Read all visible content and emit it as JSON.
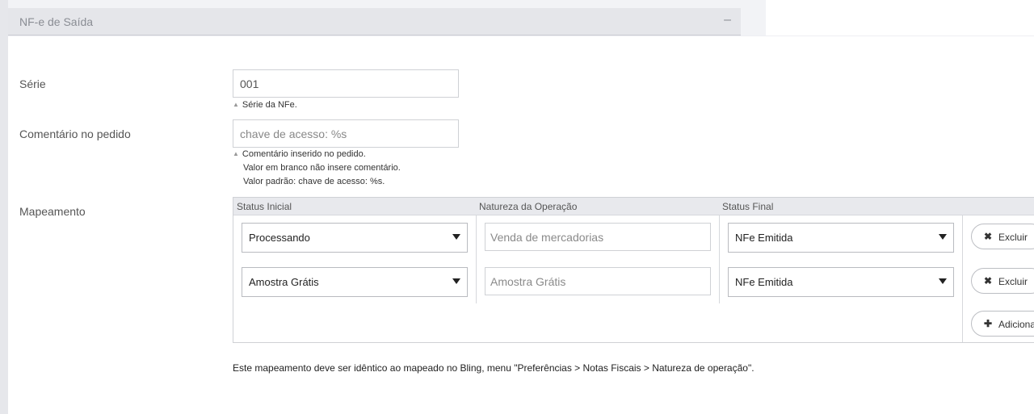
{
  "section": {
    "title": "NF-e de Saída",
    "collapse_symbol": "–"
  },
  "serie": {
    "label": "Série",
    "value": "001",
    "hint": "Série da NFe."
  },
  "comentario": {
    "label": "Comentário no pedido",
    "placeholder": "chave de acesso: %s",
    "hint_lines": [
      "Comentário inserido no pedido.",
      "Valor em branco não insere comentário.",
      "Valor padrão: chave de acesso: %s."
    ]
  },
  "mapeamento": {
    "label": "Mapeamento",
    "columns": [
      "Status Inicial",
      "Natureza da Operação",
      "Status Final"
    ],
    "rows": [
      {
        "status_inicial": "Processando",
        "natureza_placeholder": "Venda de mercadorias",
        "status_final": "NFe Emitida",
        "delete_label": "Excluir"
      },
      {
        "status_inicial": "Amostra Grátis",
        "natureza_placeholder": "Amostra Grátis",
        "status_final": "NFe Emitida",
        "delete_label": "Excluir"
      }
    ],
    "add_label": "Adicionar",
    "delete_icon": "✖",
    "add_icon": "✚",
    "note": "Este mapeamento deve ser idêntico ao mapeado no Bling, menu \"Preferências > Notas Fiscais > Natureza de operação\"."
  }
}
